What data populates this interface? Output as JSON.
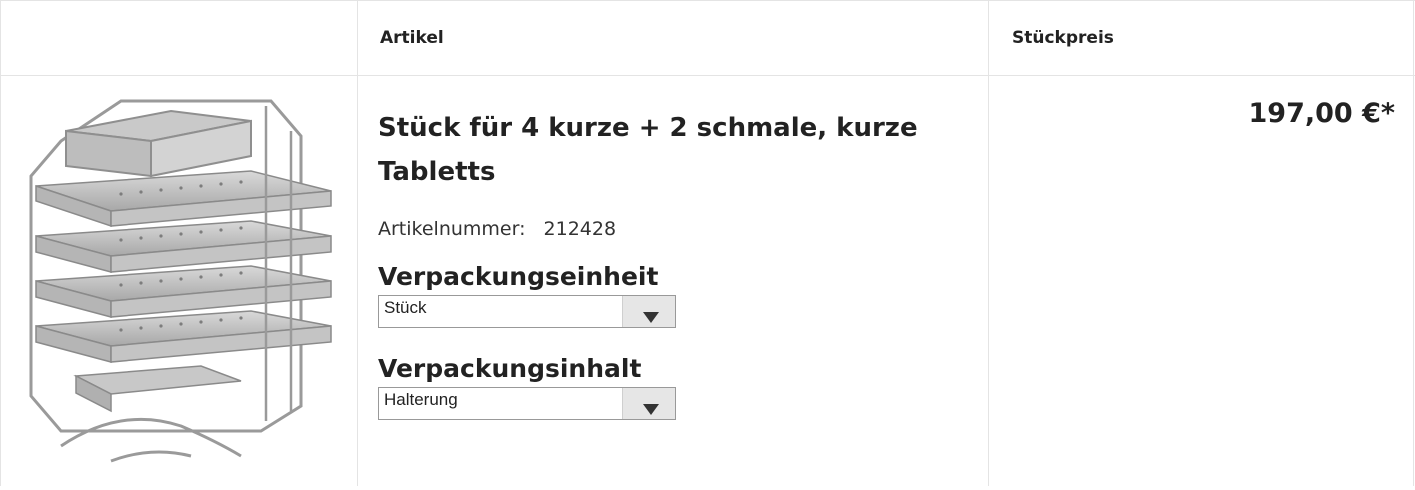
{
  "table": {
    "headers": {
      "image": "",
      "article": "Artikel",
      "unit_price": "Stückpreis"
    }
  },
  "product": {
    "image_alt": "Stainless steel rack with perforated trays",
    "title": "Stück für 4 kurze + 2 schmale, kurze Tabletts",
    "article_number_label": "Artikelnummer:",
    "article_number": "212428",
    "packaging_unit": {
      "label": "Verpackungseinheit",
      "selected": "Stück"
    },
    "packaging_content": {
      "label": "Verpackungsinhalt",
      "selected": "Halterung"
    },
    "price": "197,00 €*"
  },
  "colors": {
    "grid_line": "#e4e4e4",
    "text": "#222222",
    "select_border": "#999999",
    "select_arrow_bg": "#e6e6e6"
  }
}
